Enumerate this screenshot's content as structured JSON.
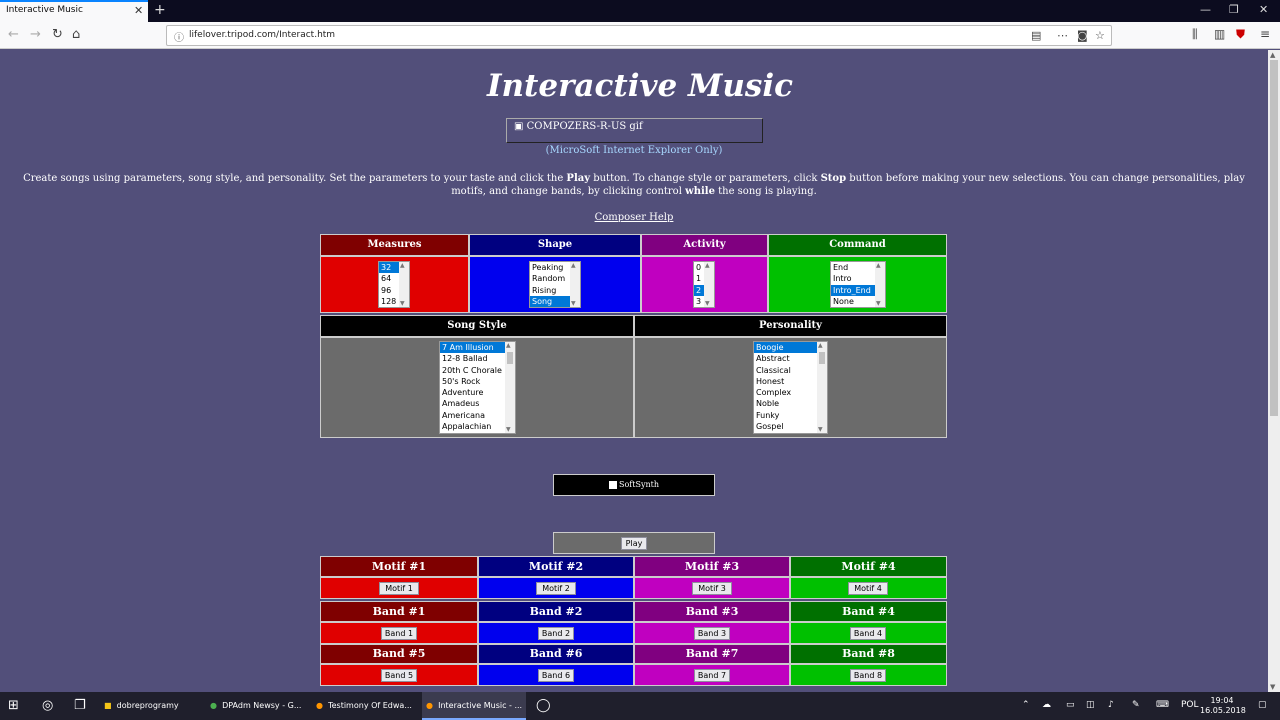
{
  "browser": {
    "tab_title": "Interactive Music",
    "close_glyph": "✕",
    "new_tab_glyph": "+",
    "url": "lifelover.tripod.com/Interact.htm",
    "controls": {
      "minimize": "—",
      "restore": "❐",
      "close": "✕"
    }
  },
  "page": {
    "title": "Interactive Music",
    "logo_alt": "COMPOZERS-R-US gif",
    "ie_note": "(MicroSoft Internet Explorer Only)",
    "intro": {
      "part1": "Create songs using parameters, song style, and personality.   Set the parameters to your taste and click the ",
      "play_word": "Play",
      "part2": " button. To change style or parameters, click ",
      "stop_word": "Stop",
      "part3": " button before making your new selections. You can change personalities, play motifs, and change bands, by clicking control ",
      "while_word": "while",
      "part4": " the song is playing."
    },
    "help_link": "Composer Help"
  },
  "params": {
    "headers": {
      "measures": "Measures",
      "shape": "Shape",
      "activity": "Activity",
      "command": "Command"
    },
    "measures_options": [
      "32",
      "64",
      "96",
      "128"
    ],
    "shape_options": [
      "Peaking",
      "Random",
      "Rising",
      "Song"
    ],
    "activity_options": [
      "0",
      "1",
      "2",
      "3"
    ],
    "command_options": [
      "End",
      "Intro",
      "Intro_End",
      "None"
    ],
    "selected": {
      "measures": "32",
      "shape": "Song",
      "activity": "2",
      "command": "Intro_End"
    }
  },
  "style": {
    "headers": {
      "song_style": "Song Style",
      "personality": "Personality"
    },
    "song_style_options": [
      "7 Am Illusion",
      "12-8 Ballad",
      "20th C Chorale",
      "50's Rock",
      "Adventure",
      "Amadeus",
      "Americana",
      "Appalachian"
    ],
    "personality_options": [
      "Boogie",
      "Abstract",
      "Classical",
      "Honest",
      "Complex",
      "Noble",
      "Funky",
      "Gospel"
    ],
    "selected": {
      "song_style": "7 Am Illusion",
      "personality": "Boogie"
    }
  },
  "softsynth_label": "SoftSynth",
  "play_label": "Play",
  "motifs": {
    "headers": [
      "Motif   #1",
      "Motif   #2",
      "Motif   #3",
      "Motif   #4"
    ],
    "buttons": [
      "Motif 1",
      "Motif 2",
      "Motif 3",
      "Motif 4"
    ]
  },
  "bands": {
    "headers": [
      "Band   #1",
      "Band   #2",
      "Band   #3",
      "Band   #4",
      "Band   #5",
      "Band   #6",
      "Band   #7",
      "Band   #8"
    ],
    "buttons": [
      "Band 1",
      "Band 2",
      "Band 3",
      "Band 4",
      "Band 5",
      "Band 6",
      "Band 7",
      "Band 8"
    ]
  },
  "colors": {
    "bg": "#524f7a",
    "red_header": "#7f0000",
    "red_body": "#e00000",
    "blue_header": "#000080",
    "blue_body": "#0000ee",
    "purple_header": "#800080",
    "purple_body": "#c000c0",
    "green_header": "#007000",
    "green_body": "#00c000",
    "black": "#000000",
    "gray": "#6b6b6b"
  },
  "taskbar": {
    "items": [
      "dobreprogramy",
      "DPAdm Newsy - G...",
      "Testimony Of Edwa...",
      "Interactive Music - ..."
    ],
    "language": "POL",
    "time": "19:04",
    "date": "16.05.2018"
  }
}
